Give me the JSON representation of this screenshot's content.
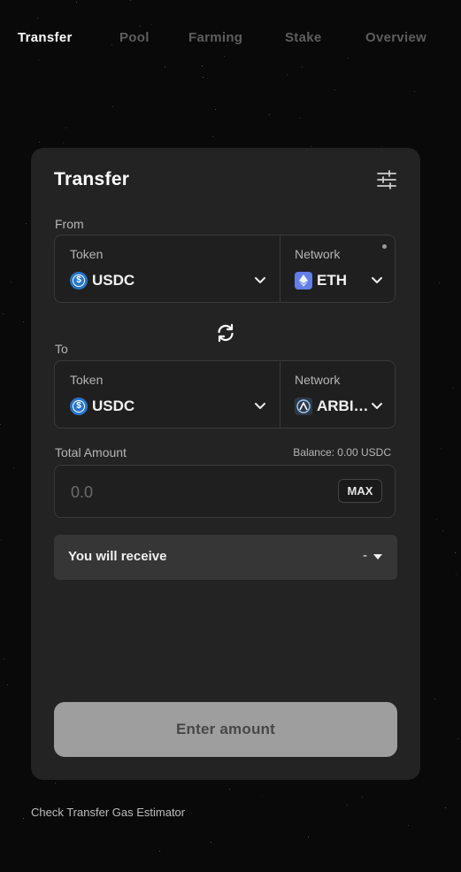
{
  "nav": {
    "items": [
      {
        "label": "Transfer",
        "active": true
      },
      {
        "label": "Pool",
        "active": false
      },
      {
        "label": "Farming",
        "active": false
      },
      {
        "label": "Stake",
        "active": false
      },
      {
        "label": "Overview",
        "active": false
      }
    ]
  },
  "card": {
    "title": "Transfer",
    "settings_icon": "sliders-icon",
    "from": {
      "label": "From",
      "token_label": "Token",
      "token_value": "USDC",
      "token_icon": "usdc-icon",
      "network_label": "Network",
      "network_value": "ETH",
      "network_icon": "ethereum-icon"
    },
    "swap_icon": "swap-arrows-icon",
    "to": {
      "label": "To",
      "token_label": "Token",
      "token_value": "USDC",
      "token_icon": "usdc-icon",
      "network_label": "Network",
      "network_value": "ARBI…",
      "network_icon": "arbitrum-icon"
    },
    "amount": {
      "label": "Total Amount",
      "balance": "Balance: 0.00 USDC",
      "placeholder": "0.0",
      "max_label": "MAX"
    },
    "receive": {
      "label": "You will receive",
      "value": "-"
    },
    "submit_label": "Enter amount"
  },
  "footer": {
    "link": "Check Transfer Gas Estimator"
  },
  "colors": {
    "background": "#090909",
    "card": "#232323",
    "usdc": "#2775ca",
    "ethereum": "#627eea",
    "button_disabled": "#9e9e9e"
  }
}
